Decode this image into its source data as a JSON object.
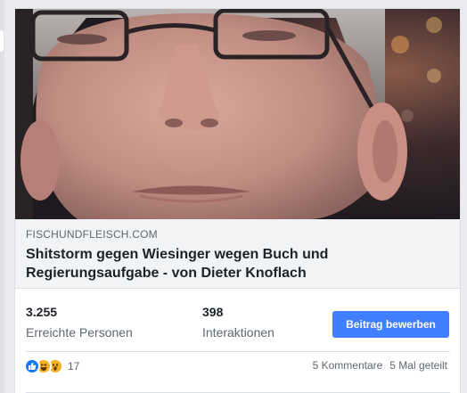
{
  "link_preview": {
    "domain": "FISCHUNDFLEISCH.COM",
    "title": "Shitstorm gegen Wiesinger wegen Buch und Regierungsaufgabe - von Dieter Knoflach"
  },
  "stats": {
    "reach_value": "3.255",
    "reach_label": "Erreichte Personen",
    "engagement_value": "398",
    "engagement_label": "Interaktionen"
  },
  "boost_button_label": "Beitrag bewerben",
  "footer": {
    "reactions": [
      "like-icon",
      "haha-icon",
      "wow-icon"
    ],
    "reaction_count": "17",
    "comments": "5 Kommentare",
    "shares": "5 Mal geteilt"
  },
  "colors": {
    "accent": "#4080ff",
    "like": "#1877f2",
    "emoji": "#f7b125"
  }
}
